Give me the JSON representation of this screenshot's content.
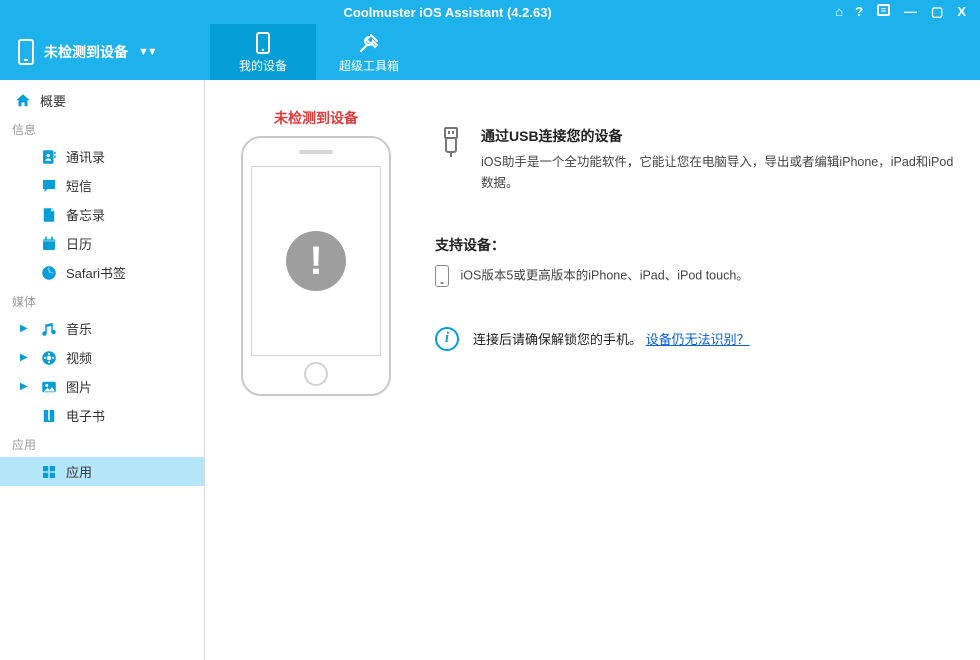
{
  "window": {
    "title": "Coolmuster iOS Assistant (4.2.63)"
  },
  "header": {
    "device_status": "未检测到设备",
    "tabs": {
      "my_device": "我的设备",
      "toolkit": "超级工具箱"
    }
  },
  "sidebar": {
    "overview": "概要",
    "groups": {
      "info_header": "信息",
      "media_header": "媒体",
      "apps_header": "应用"
    },
    "items": {
      "contacts": "通讯录",
      "sms": "短信",
      "notes": "备忘录",
      "calendar": "日历",
      "safari": "Safari书签",
      "music": "音乐",
      "video": "视频",
      "photos": "图片",
      "ebooks": "电子书",
      "apps": "应用"
    }
  },
  "main": {
    "not_detected": "未检测到设备",
    "usb": {
      "title": "通过USB连接您的设备",
      "desc": "iOS助手是一个全功能软件，它能让您在电脑导入，导出或者编辑iPhone，iPad和iPod数据。"
    },
    "support": {
      "title": "支持设备：",
      "line": "iOS版本5或更高版本的iPhone、iPad、iPod touch。"
    },
    "tip": {
      "text": "连接后请确保解锁您的手机。",
      "link": "设备仍无法识别？"
    }
  }
}
